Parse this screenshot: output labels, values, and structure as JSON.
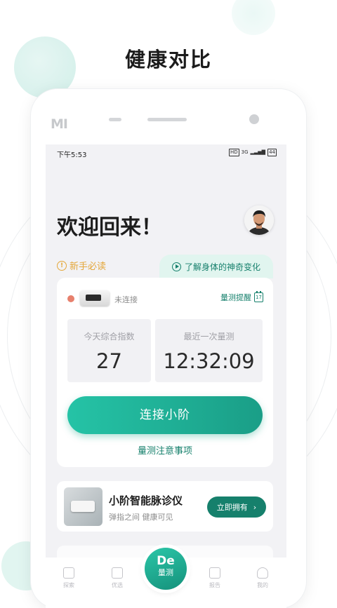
{
  "promo": {
    "title": "健康对比"
  },
  "device": {
    "brand": "MI"
  },
  "status_bar": {
    "time": "下午5:53",
    "icons": [
      "HD",
      "3G",
      "signal",
      "44"
    ]
  },
  "header": {
    "welcome": "欢迎回来！",
    "avatar_icon": "user-avatar"
  },
  "tips": {
    "newbie": "新手必读",
    "newbie_icon": "!",
    "learn_change": "了解身体的神奇变化"
  },
  "connection": {
    "status": "未连接",
    "reminder_label": "量测提醒",
    "calendar_day": "17",
    "today_index_label": "今天综合指数",
    "today_index_value": "27",
    "last_measure_label": "最近一次量测",
    "last_measure_value": "12:32:09",
    "connect_button": "连接小阶",
    "notes_link": "量测注意事项"
  },
  "product": {
    "name": "小阶智能脉诊仪",
    "slogan": "弹指之间 健康可见",
    "button": "立即拥有",
    "button_icon": "›"
  },
  "tabbar": {
    "items": [
      {
        "label": "探索",
        "icon": "home-icon"
      },
      {
        "label": "优选",
        "icon": "shop-icon"
      },
      {
        "label": "报告",
        "icon": "report-icon"
      },
      {
        "label": "我的",
        "icon": "person-icon"
      }
    ],
    "center": {
      "logo": "De",
      "label": "量测"
    }
  },
  "colors": {
    "accent": "#16806c",
    "accent_light": "#25c3a6",
    "warning": "#e4a73a",
    "status_dot": "#e7806d"
  }
}
